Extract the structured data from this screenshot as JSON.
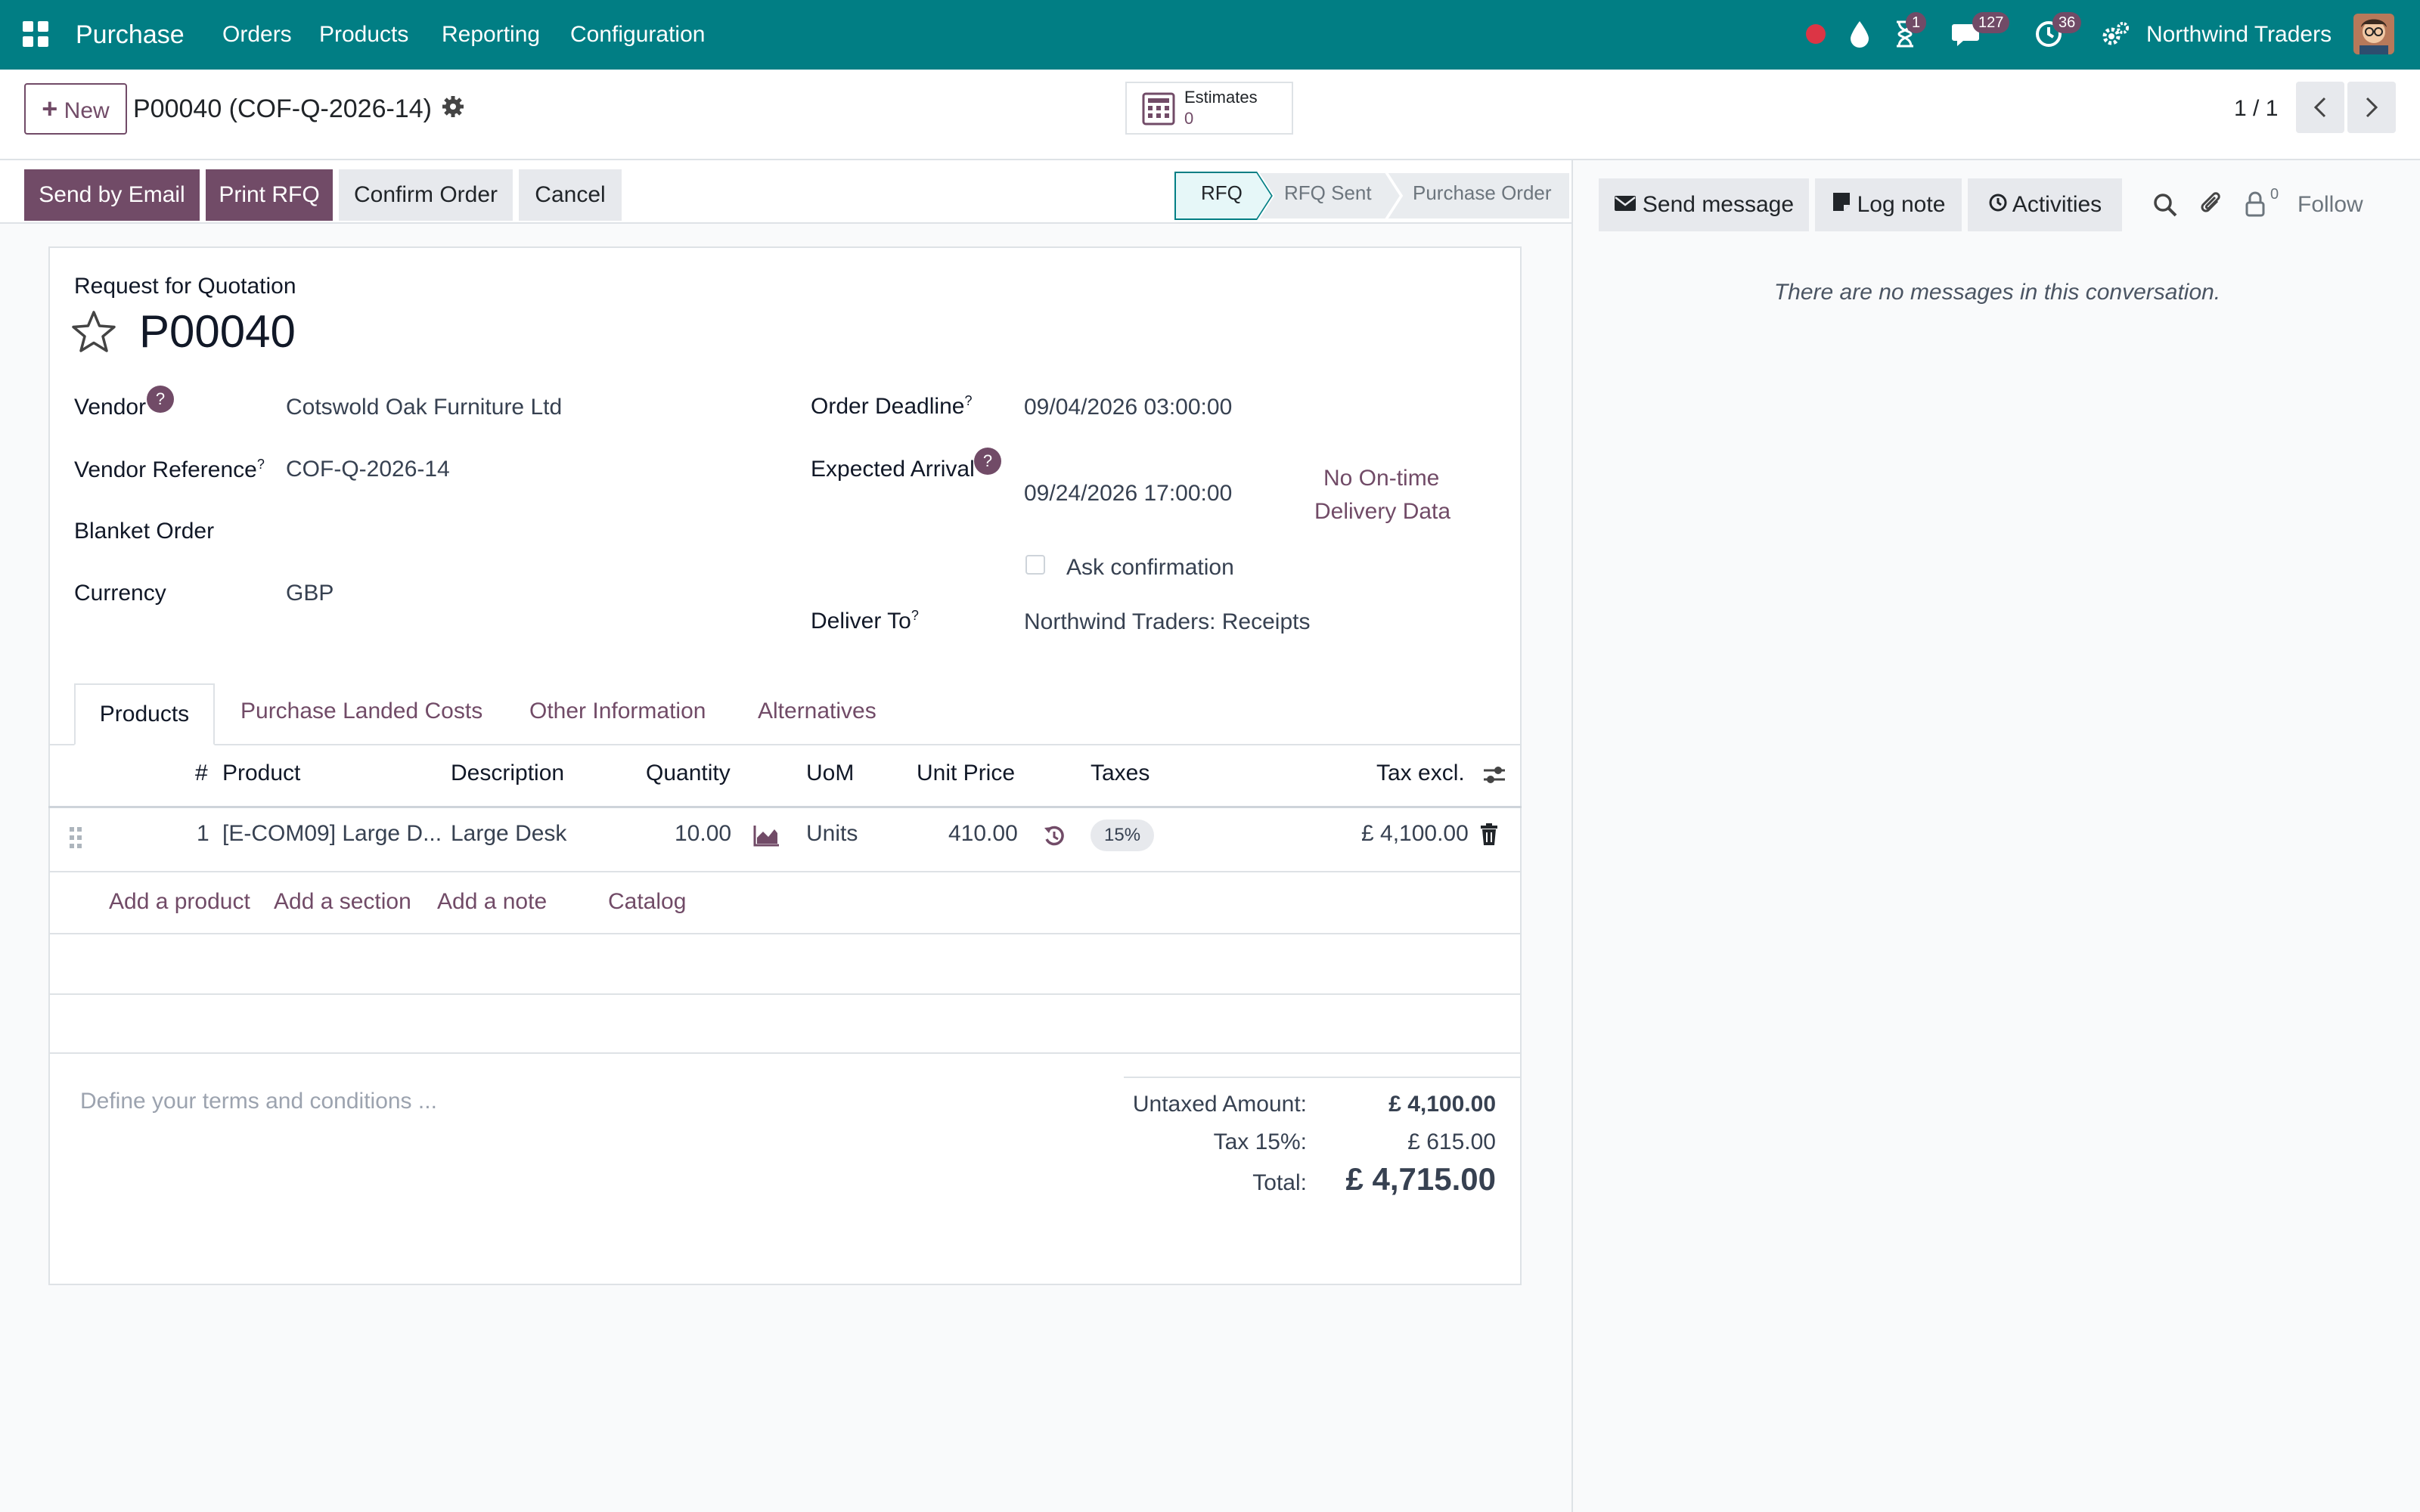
{
  "navbar": {
    "app_name": "Purchase",
    "menus": [
      "Orders",
      "Products",
      "Reporting",
      "Configuration"
    ],
    "activity_badge": "1",
    "messages_badge": "127",
    "clock_badge": "36",
    "company": "Northwind Traders"
  },
  "control": {
    "new_label": "New",
    "new_icon": "plus",
    "breadcrumb": "P00040 (COF-Q-2026-14)",
    "estimates_label": "Estimates",
    "estimates_count": "0",
    "pager": "1 / 1"
  },
  "actions": {
    "send_email": "Send by Email",
    "print_rfq": "Print RFQ",
    "confirm": "Confirm Order",
    "cancel": "Cancel"
  },
  "status": {
    "steps": [
      "RFQ",
      "RFQ Sent",
      "Purchase Order"
    ],
    "active": "RFQ"
  },
  "form": {
    "subtitle": "Request for Quotation",
    "name": "P00040",
    "vendor_label": "Vendor",
    "vendor": "Cotswold Oak Furniture Ltd",
    "vendor_ref_label": "Vendor Reference",
    "vendor_ref": "COF-Q-2026-14",
    "blanket_label": "Blanket Order",
    "currency_label": "Currency",
    "currency": "GBP",
    "deadline_label": "Order Deadline",
    "deadline": "09/04/2026 03:00:00",
    "arrival_label": "Expected Arrival",
    "arrival": "09/24/2026 17:00:00",
    "ontime_line1": "No On-time",
    "ontime_line2": "Delivery Data",
    "ask_confirm": "Ask confirmation",
    "deliver_label": "Deliver To",
    "deliver_to": "Northwind Traders: Receipts",
    "qmark": "?",
    "sup": "?"
  },
  "tabs": [
    "Products",
    "Purchase Landed Costs",
    "Other Information",
    "Alternatives"
  ],
  "table": {
    "headers": [
      "#",
      "Product",
      "Description",
      "Quantity",
      "UoM",
      "Unit Price",
      "Taxes",
      "Tax excl."
    ],
    "rows": [
      {
        "num": "1",
        "product": "[E-COM09] Large D...",
        "description": "Large Desk",
        "quantity": "10.00",
        "uom": "Units",
        "unit_price": "410.00",
        "tax": "15%",
        "subtotal": "£ 4,100.00"
      }
    ],
    "add_links": [
      "Add a product",
      "Add a section",
      "Add a note",
      "Catalog"
    ]
  },
  "terms_placeholder": "Define your terms and conditions ...",
  "totals": {
    "untaxed_label": "Untaxed Amount:",
    "untaxed": "£ 4,100.00",
    "tax_label": "Tax 15%:",
    "tax": "£ 615.00",
    "total_label": "Total:",
    "total": "£ 4,715.00"
  },
  "chatter": {
    "send_message": "Send message",
    "log_note": "Log note",
    "activities": "Activities",
    "followers_count": "0",
    "follow": "Follow",
    "empty": "There are no messages in this conversation."
  },
  "colors": {
    "navbar": "#017e84",
    "primary": "#714b67",
    "status_active": "#e6f7f8"
  }
}
